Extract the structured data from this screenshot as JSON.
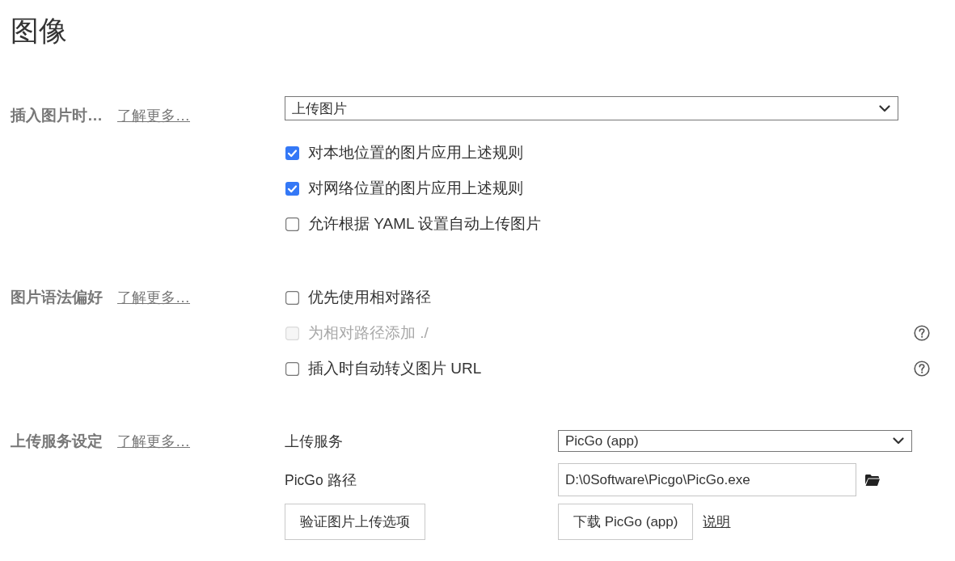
{
  "title": "图像",
  "sections": [
    {
      "label": "插入图片时…",
      "link": "了解更多…",
      "items": [
        {
          "kind": "select",
          "value": "上传图片"
        },
        {
          "kind": "checkbox",
          "label": "对本地位置的图片应用上述规则",
          "checked": true,
          "disabled": false,
          "help": false
        },
        {
          "kind": "checkbox",
          "label": "对网络位置的图片应用上述规则",
          "checked": true,
          "disabled": false,
          "help": false
        },
        {
          "kind": "checkbox",
          "label": "允许根据 YAML 设置自动上传图片",
          "checked": false,
          "disabled": false,
          "help": false
        }
      ]
    },
    {
      "label": "图片语法偏好",
      "link": "了解更多…",
      "items": [
        {
          "kind": "checkbox",
          "label": "优先使用相对路径",
          "checked": false,
          "disabled": false,
          "help": false
        },
        {
          "kind": "checkbox",
          "label": "为相对路径添加 ./",
          "checked": false,
          "disabled": true,
          "help": true
        },
        {
          "kind": "checkbox",
          "label": "插入时自动转义图片 URL",
          "checked": false,
          "disabled": false,
          "help": true
        }
      ]
    },
    {
      "label": "上传服务设定",
      "link": "了解更多…",
      "items": [
        {
          "kind": "labeled-select",
          "label": "上传服务",
          "value": "PicGo (app)"
        },
        {
          "kind": "path",
          "label": "PicGo 路径",
          "value": "D:\\0Software\\Picgo\\PicGo.exe"
        },
        {
          "kind": "actions",
          "buttons": [
            "验证图片上传选项",
            "下载 PicGo (app)"
          ],
          "link": "说明"
        }
      ]
    }
  ]
}
